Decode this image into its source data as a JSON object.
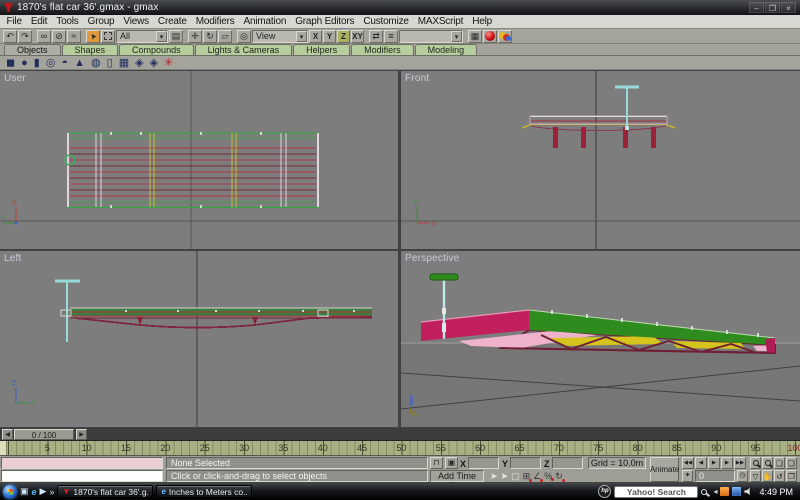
{
  "window": {
    "title": "1870's flat car 36'.gmax - gmax"
  },
  "menu": {
    "items": [
      "File",
      "Edit",
      "Tools",
      "Group",
      "Views",
      "Create",
      "Modifiers",
      "Animation",
      "Graph Editors",
      "Customize",
      "MAXScript",
      "Help"
    ]
  },
  "toolbar": {
    "selection_filter": "All",
    "coord_system": "View",
    "named_selection": "",
    "axis": [
      "X",
      "Y",
      "Z",
      "XY"
    ]
  },
  "tabs": {
    "items": [
      "Objects",
      "Shapes",
      "Compounds",
      "Lights & Cameras",
      "Helpers",
      "Modifiers",
      "Modeling"
    ],
    "active": "Objects"
  },
  "viewports": {
    "user": "User",
    "front": "Front",
    "left": "Left",
    "perspective": "Perspective"
  },
  "time_slider": {
    "value": "0 / 100"
  },
  "timeline": {
    "ticks": [
      5,
      10,
      15,
      20,
      25,
      30,
      35,
      40,
      45,
      50,
      55,
      60,
      65,
      70,
      75,
      80,
      85,
      90,
      95,
      100
    ]
  },
  "status": {
    "selection": "None Selected",
    "prompt": "Click or click-and-drag to select objects",
    "add_time_tag": "Add Time Tag",
    "grid": "Grid = 10.0m",
    "animate": "Animate",
    "x_label": "X",
    "y_label": "Y",
    "z_label": "Z",
    "x_value": "",
    "y_value": "",
    "z_value": "",
    "frame": "0"
  },
  "taskbar": {
    "tasks": [
      {
        "label": "1870's flat car 36'.g..."
      },
      {
        "label": "Inches to Meters co..."
      }
    ],
    "search": "Yahoo! Search",
    "clock": "4:49 PM"
  },
  "colors": {
    "viewport_bg": "#7d7d7d",
    "deck_green": "#2e8c1e",
    "wire_green": "#3da04a",
    "stringer_red": "#b03545",
    "beam_yellow": "#c8bc2e",
    "brake_cyan": "#96dada",
    "end_magenta": "#c21f5e",
    "underside_pink": "#eeb2cc",
    "truss_maroon": "#6e1f33",
    "timeline_olive": "#a7b183",
    "tab_green": "#b6ce9e",
    "active_select_orange": "#e09a3c",
    "active_axis_green": "#aab061"
  },
  "icons": {
    "dropdown_arrow": "▾",
    "undo": "↶",
    "redo": "↷",
    "select_link": "∞",
    "unlink": "⊘",
    "bind_spacewarp": "≈",
    "select_cursor": "➤",
    "select_by_name": "▤",
    "move": "✛",
    "rotate": "↻",
    "scale": "▱",
    "use_center": "◎",
    "mirror": "⇄",
    "align": "≡",
    "track_view": "▦",
    "box": "◼",
    "sphere": "●",
    "cylinder": "▮",
    "torus": "◎",
    "teapot": "◓",
    "cone": "▲",
    "geosphere": "◍",
    "tube": "▯",
    "plane": "▦",
    "helper_a": "◈",
    "helper_b": "◈",
    "space_warp": "✳",
    "go_start": "◀◀",
    "prev_frame": "◀",
    "play": "▶",
    "next_frame": "▶",
    "go_end": "▶▶",
    "key_mode": "✦",
    "time_config": "◷",
    "zoom_extents": "❑",
    "zoom_extents_all": "❏",
    "fov": "▽",
    "pan": "✋",
    "arc_rotate": "↺",
    "min_max": "❐",
    "lock": "⊓",
    "abs_mode": "▣",
    "snap_cursor": "➤",
    "snap_inc": "➤",
    "snap_cube": "▢",
    "snap_3d": "⊞",
    "snap_angle": "∠",
    "snap_percent": "%",
    "snap_spinner": "↻",
    "left_arrow": "◀",
    "right_arrow": "▶",
    "minimize": "–",
    "maximize": "❐",
    "close": "×",
    "quick_desktop": "▣",
    "quick_ie": "e",
    "quick_media": "▶",
    "overflow": "»",
    "task_gmax": "▼",
    "tray_expand": "◂"
  }
}
